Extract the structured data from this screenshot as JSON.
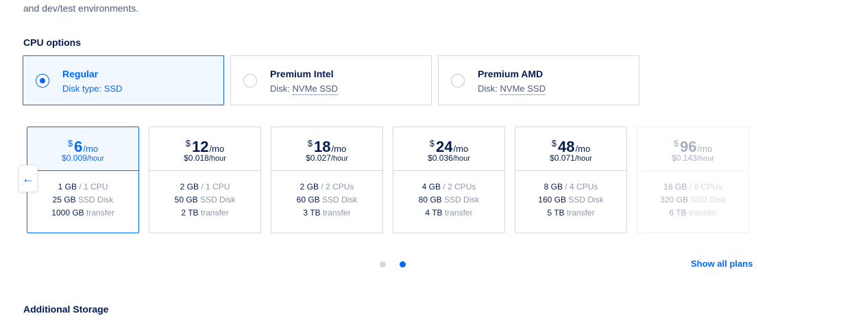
{
  "intro_text": "and dev/test environments.",
  "cpu_section": {
    "title": "CPU options",
    "options": [
      {
        "name": "Regular",
        "disk_label": "Disk type:",
        "disk_value": "SSD",
        "selected": true
      },
      {
        "name": "Premium Intel",
        "disk_label": "Disk:",
        "disk_value": "NVMe SSD",
        "selected": false
      },
      {
        "name": "Premium AMD",
        "disk_label": "Disk:",
        "disk_value": "NVMe SSD",
        "selected": false
      }
    ]
  },
  "plans": [
    {
      "currency": "$",
      "price": "6",
      "per": "/mo",
      "hourly": "$0.009",
      "hourly_unit": "/hour",
      "memory": "1 GB",
      "cpu": "/ 1 CPU",
      "disk": "25 GB",
      "disk_type": "SSD Disk",
      "transfer": "1000 GB",
      "transfer_label": "transfer",
      "selected": true
    },
    {
      "currency": "$",
      "price": "12",
      "per": "/mo",
      "hourly": "$0.018",
      "hourly_unit": "/hour",
      "memory": "2 GB",
      "cpu": "/ 1 CPU",
      "disk": "50 GB",
      "disk_type": "SSD Disk",
      "transfer": "2 TB",
      "transfer_label": "transfer"
    },
    {
      "currency": "$",
      "price": "18",
      "per": "/mo",
      "hourly": "$0.027",
      "hourly_unit": "/hour",
      "memory": "2 GB",
      "cpu": "/ 2 CPUs",
      "disk": "60 GB",
      "disk_type": "SSD Disk",
      "transfer": "3 TB",
      "transfer_label": "transfer"
    },
    {
      "currency": "$",
      "price": "24",
      "per": "/mo",
      "hourly": "$0.036",
      "hourly_unit": "/hour",
      "memory": "4 GB",
      "cpu": "/ 2 CPUs",
      "disk": "80 GB",
      "disk_type": "SSD Disk",
      "transfer": "4 TB",
      "transfer_label": "transfer"
    },
    {
      "currency": "$",
      "price": "48",
      "per": "/mo",
      "hourly": "$0.071",
      "hourly_unit": "/hour",
      "memory": "8 GB",
      "cpu": "/ 4 CPUs",
      "disk": "160 GB",
      "disk_type": "SSD Disk",
      "transfer": "5 TB",
      "transfer_label": "transfer"
    },
    {
      "currency": "$",
      "price": "96",
      "per": "/mo",
      "hourly": "$0.143",
      "hourly_unit": "/hour",
      "memory": "16 GB",
      "cpu": "/ 8 CPUs",
      "disk": "320 GB",
      "disk_type": "SSD Disk",
      "transfer": "6 TB",
      "transfer_label": "transfer",
      "disabled": true
    }
  ],
  "carousel": {
    "prev_icon": "arrow-left-icon",
    "prev_glyph": "←",
    "page_count": 2,
    "active_page": 2
  },
  "show_all_label": "Show all plans",
  "storage_title": "Additional Storage",
  "colors": {
    "accent": "#0069ff",
    "text": "#031b4e",
    "muted": "#8c96ab",
    "border": "#d2d8e2",
    "selected_bg": "#f2f8ff"
  }
}
